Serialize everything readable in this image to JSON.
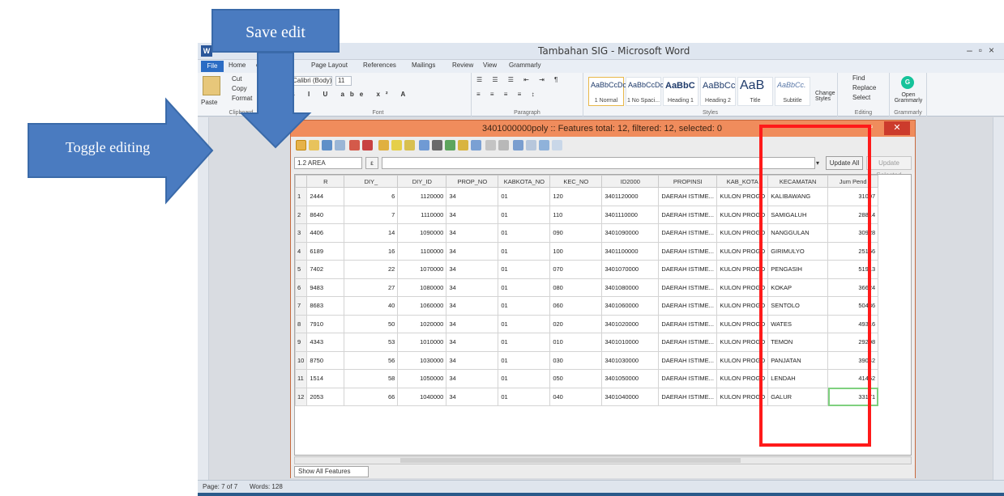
{
  "word": {
    "title": "Tambahan SIG - Microsoft Word",
    "tabs": [
      "File",
      "Home",
      "ert",
      "Page Layout",
      "References",
      "Mailings",
      "Review",
      "View",
      "Grammarly"
    ],
    "clipboard": {
      "cut": "Cut",
      "copy": "Copy",
      "paste": "Paste",
      "format": "Format",
      "label": "Clipboard"
    },
    "font": {
      "name": "Calibri (Body)",
      "size": "11",
      "label": "Font"
    },
    "paragraph_label": "Paragraph",
    "styles": [
      {
        "sample": "AaBbCcDc",
        "name": "1 Normal"
      },
      {
        "sample": "AaBbCcDc",
        "name": "1 No Spaci..."
      },
      {
        "sample": "AaBbC",
        "name": "Heading 1"
      },
      {
        "sample": "AaBbCc",
        "name": "Heading 2"
      },
      {
        "sample": "AaB",
        "name": "Title"
      },
      {
        "sample": "AaBbCc.",
        "name": "Subtitle"
      }
    ],
    "styles_label": "Styles",
    "change_styles": "Change Styles",
    "editing": {
      "find": "Find",
      "replace": "Replace",
      "select": "Select",
      "label": "Editing"
    },
    "grammarly": {
      "open": "Open Grammarly",
      "label": "Grammarly"
    },
    "status": {
      "page": "Page: 7 of 7",
      "words": "Words: 128"
    }
  },
  "dialog": {
    "title": "3401000000poly :: Features total: 12, filtered: 12, selected: 0",
    "field": "1.2 AREA",
    "epsilon": "ε",
    "update_all": "Update All",
    "update_selected": "Update Selected",
    "show_all": "Show All Features",
    "columns": [
      "R",
      "DIY_",
      "DIY_ID",
      "PROP_NO",
      "KABKOTA_NO",
      "KEC_NO",
      "ID2000",
      "PROPINSI",
      "KAB_KOTA",
      "KECAMATAN",
      "Jum Pend"
    ],
    "rows": [
      [
        "2444",
        "6",
        "1120000",
        "34",
        "01",
        "120",
        "3401120000",
        "DAERAH ISTIME...",
        "KULON PROGO",
        "KALIBAWANG",
        "31007"
      ],
      [
        "8640",
        "7",
        "1110000",
        "34",
        "01",
        "110",
        "3401110000",
        "DAERAH ISTIME...",
        "KULON PROGO",
        "SAMIGALUH",
        "28814"
      ],
      [
        "4406",
        "14",
        "1090000",
        "34",
        "01",
        "090",
        "3401090000",
        "DAERAH ISTIME...",
        "KULON PROGO",
        "NANGGULAN",
        "30928"
      ],
      [
        "6189",
        "16",
        "1100000",
        "34",
        "01",
        "100",
        "3401100000",
        "DAERAH ISTIME...",
        "KULON PROGO",
        "GIRIMULYO",
        "25156"
      ],
      [
        "7402",
        "22",
        "1070000",
        "34",
        "01",
        "070",
        "3401070000",
        "DAERAH ISTIME...",
        "KULON PROGO",
        "PENGASIH",
        "51913"
      ],
      [
        "9483",
        "27",
        "1080000",
        "34",
        "01",
        "080",
        "3401080000",
        "DAERAH ISTIME...",
        "KULON PROGO",
        "KOKAP",
        "36624"
      ],
      [
        "8683",
        "40",
        "1060000",
        "34",
        "01",
        "060",
        "3401060000",
        "DAERAH ISTIME...",
        "KULON PROGO",
        "SENTOLO",
        "50436"
      ],
      [
        "7910",
        "50",
        "1020000",
        "34",
        "01",
        "020",
        "3401020000",
        "DAERAH ISTIME...",
        "KULON PROGO",
        "WATES",
        "49316"
      ],
      [
        "4343",
        "53",
        "1010000",
        "34",
        "01",
        "010",
        "3401010000",
        "DAERAH ISTIME...",
        "KULON PROGO",
        "TEMON",
        "29298"
      ],
      [
        "8750",
        "56",
        "1030000",
        "34",
        "01",
        "030",
        "3401030000",
        "DAERAH ISTIME...",
        "KULON PROGO",
        "PANJATAN",
        "39042"
      ],
      [
        "1514",
        "58",
        "1050000",
        "34",
        "01",
        "050",
        "3401050000",
        "DAERAH ISTIME...",
        "KULON PROGO",
        "LENDAH",
        "41452"
      ],
      [
        "2053",
        "66",
        "1040000",
        "34",
        "01",
        "040",
        "3401040000",
        "DAERAH ISTIME...",
        "KULON PROGO",
        "GALUR",
        "33171"
      ]
    ]
  },
  "annotations": {
    "save_edit": "Save edit",
    "toggle_editing": "Toggle editing",
    "arrow_color": "#4a7bc0",
    "highlight_color": "#ff1a1a"
  }
}
